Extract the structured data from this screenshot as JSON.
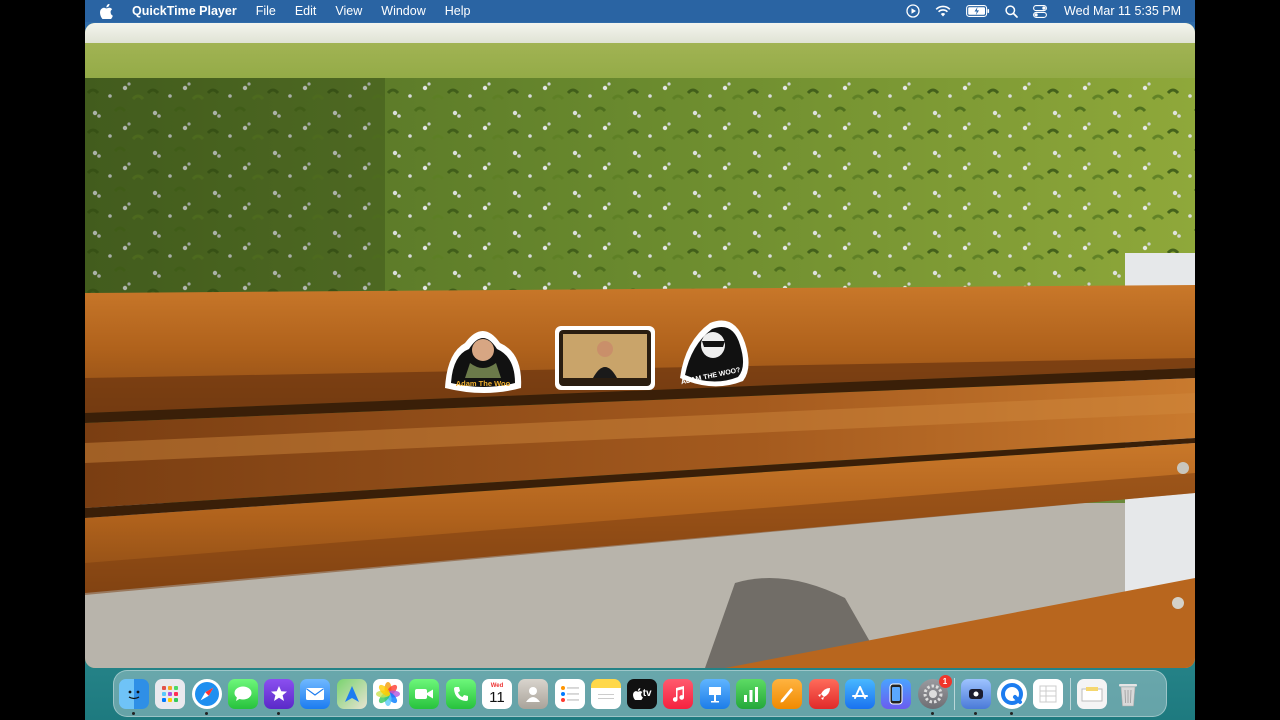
{
  "menubar": {
    "app_name": "QuickTime Player",
    "menus": [
      "File",
      "Edit",
      "View",
      "Window",
      "Help"
    ],
    "clock": "Wed Mar 11  5:35 PM"
  },
  "video": {
    "sticker_left_text": "Adam The Woo",
    "sticker_right_text": "ADAM THE WOO?"
  },
  "dock": {
    "calendar": {
      "month_day": "Wed",
      "day": "11"
    },
    "appletv_label": "tv",
    "system_settings_badge": "1",
    "apps": [
      "Finder",
      "Launchpad",
      "Safari",
      "Messages",
      "iMovie",
      "Mail",
      "Maps",
      "Photos",
      "FaceTime",
      "Phone",
      "Calendar",
      "Contacts",
      "Reminders",
      "Notes",
      "Apple TV",
      "Music",
      "Keynote",
      "Numbers",
      "Pages",
      "Rocket",
      "App Store",
      "iPhone Mirroring",
      "System Settings",
      "Screen Recorder",
      "QuickTime",
      "Document",
      "Downloads",
      "Trash"
    ]
  }
}
